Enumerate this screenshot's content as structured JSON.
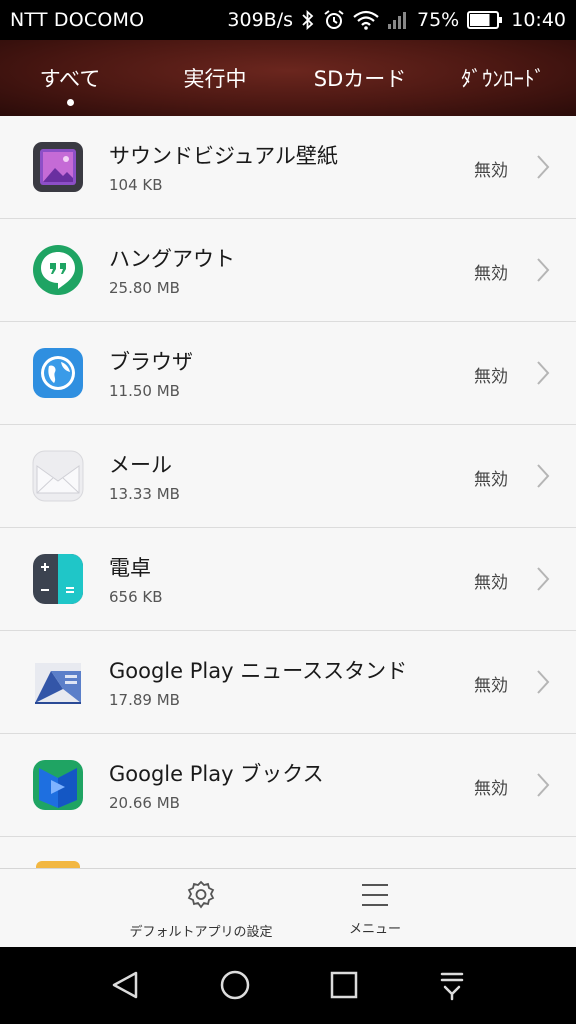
{
  "status_bar": {
    "carrier": "NTT DOCOMO",
    "speed": "309B/s",
    "battery": "75%",
    "time": "10:40",
    "battery_level": 0.75
  },
  "tabs": [
    {
      "label": "すべて",
      "selected": true
    },
    {
      "label": "実行中",
      "selected": false
    },
    {
      "label": "SDカード",
      "selected": false
    },
    {
      "label": "ﾀﾞｳﾝﾛｰﾄﾞ",
      "selected": false
    }
  ],
  "apps": [
    {
      "name": "サウンドビジュアル壁紙",
      "size": "104 KB",
      "status": "無効",
      "icon": "photo-frame-icon"
    },
    {
      "name": "ハングアウト",
      "size": "25.80 MB",
      "status": "無効",
      "icon": "hangouts-icon"
    },
    {
      "name": "ブラウザ",
      "size": "11.50 MB",
      "status": "無効",
      "icon": "browser-globe-icon"
    },
    {
      "name": "メール",
      "size": "13.33 MB",
      "status": "無効",
      "icon": "mail-envelope-icon"
    },
    {
      "name": "電卓",
      "size": "656 KB",
      "status": "無効",
      "icon": "calculator-icon"
    },
    {
      "name": "Google Play ニューススタンド",
      "size": "17.89 MB",
      "status": "無効",
      "icon": "newsstand-icon"
    },
    {
      "name": "Google Play ブックス",
      "size": "20.66 MB",
      "status": "無効",
      "icon": "play-books-icon"
    }
  ],
  "bottom_bar": {
    "default_apps_label": "デフォルトアプリの設定",
    "menu_label": "メニュー"
  },
  "colors": {
    "header": "#4a1712",
    "background": "#f7f7f7",
    "hangouts_green": "#1fa463",
    "browser_blue": "#2f8fe0",
    "calculator_teal": "#1fc6c8"
  }
}
